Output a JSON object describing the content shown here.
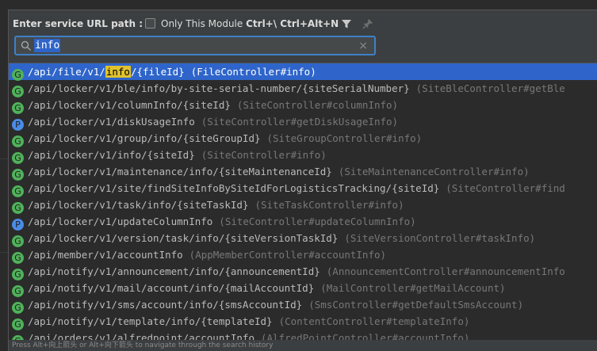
{
  "header": {
    "title": "Enter service URL path :",
    "checkbox_label": "Only This Module",
    "checkbox_shortcuts": "Ctrl+\\ Ctrl+Alt+N",
    "filter_icon": "filter-icon",
    "pin_icon": "pin-icon"
  },
  "search": {
    "value": "info",
    "icon": "search-icon",
    "clear": "×"
  },
  "results": [
    {
      "badge": "G",
      "before": "/api/file/v1/",
      "match": "info",
      "after": "/{fileId}",
      "controller": "(FileController#info)",
      "selected": true
    },
    {
      "badge": "G",
      "path": "/api/locker/v1/ble/info/by-site-serial-number/{siteSerialNumber}",
      "controller": "(SiteBleController#getBle"
    },
    {
      "badge": "G",
      "path": "/api/locker/v1/columnInfo/{siteId}",
      "controller": "(SiteController#columnInfo)"
    },
    {
      "badge": "P",
      "path": "/api/locker/v1/diskUsageInfo",
      "controller": "(SiteController#getDiskUsageInfo)"
    },
    {
      "badge": "G",
      "path": "/api/locker/v1/group/info/{siteGroupId}",
      "controller": "(SiteGroupController#info)"
    },
    {
      "badge": "G",
      "path": "/api/locker/v1/info/{siteId}",
      "controller": "(SiteController#info)"
    },
    {
      "badge": "G",
      "path": "/api/locker/v1/maintenance/info/{siteMaintenanceId}",
      "controller": "(SiteMaintenanceController#info)"
    },
    {
      "badge": "G",
      "path": "/api/locker/v1/site/findSiteInfoBySiteIdForLogisticsTracking/{siteId}",
      "controller": "(SiteController#find"
    },
    {
      "badge": "G",
      "path": "/api/locker/v1/task/info/{siteTaskId}",
      "controller": "(SiteTaskController#info)"
    },
    {
      "badge": "P",
      "path": "/api/locker/v1/updateColumnInfo",
      "controller": "(SiteController#updateColumnInfo)"
    },
    {
      "badge": "G",
      "path": "/api/locker/v1/version/task/info/{siteVersionTaskId}",
      "controller": "(SiteVersionController#taskInfo)"
    },
    {
      "badge": "G",
      "path": "/api/member/v1/accountInfo",
      "controller": "(AppMemberController#accountInfo)"
    },
    {
      "badge": "G",
      "path": "/api/notify/v1/announcement/info/{announcementId}",
      "controller": "(AnnouncementController#announcementInfo"
    },
    {
      "badge": "G",
      "path": "/api/notify/v1/mail/account/info/{mailAccountId}",
      "controller": "(MailController#getMailAccount)"
    },
    {
      "badge": "G",
      "path": "/api/notify/v1/sms/account/info/{smsAccountId}",
      "controller": "(SmsController#getDefaultSmsAccount)"
    },
    {
      "badge": "G",
      "path": "/api/notify/v1/template/info/{templateId}",
      "controller": "(ContentController#templateInfo)"
    },
    {
      "badge": "G",
      "path": "/api/orders/v1/alfredpoint/accountInfo",
      "controller": "(AlfredPointController#accountInfo)"
    }
  ],
  "footer": {
    "hint": "Press Alt+向上箭头 or Alt+向下箭头 to navigate through the search history"
  },
  "colors": {
    "selection": "#2f65ca",
    "match_highlight": "#e0c22c",
    "get_badge": "#4fb25a",
    "post_badge": "#4a8be6"
  }
}
